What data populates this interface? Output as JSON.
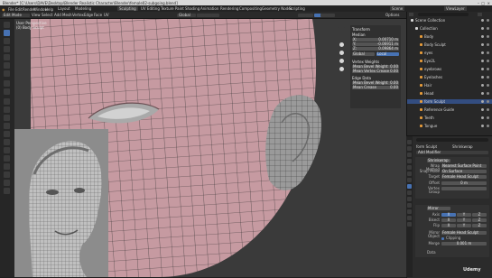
{
  "titlebar": {
    "title": "Blender* [C:\\Users\\DAVE\\Desktop\\Blender Realistic Character\\Blender\\female02-subgoing.blend]"
  },
  "menubar": {
    "menus": [
      "File",
      "Edit",
      "Render",
      "Window",
      "Help"
    ],
    "workspaces": [
      "Layout",
      "Modeling",
      "Sculpting",
      "UV Editing",
      "Texture Paint",
      "Shading",
      "Animation",
      "Rendering",
      "Compositing",
      "Geometry Nodes",
      "Scripting"
    ],
    "active_workspace": "Modeling",
    "scene_label": "Scene",
    "view_layer_label": "ViewLayer"
  },
  "header": {
    "mode": "Edit Mode",
    "menus": [
      "View",
      "Select",
      "Add",
      "Mesh",
      "Vertex",
      "Edge",
      "Face",
      "UV"
    ],
    "orientation": "Global",
    "options_label": "Options"
  },
  "viewport": {
    "view_name": "User Perspective",
    "object_name": "(0) Body Sculpt",
    "accent_skin": "#c89aa0",
    "ref_bg": "#8c8c8c",
    "watermark": "Udemy"
  },
  "npanel": {
    "transform_title": "Transform",
    "median_label": "Median",
    "x_label": "X:",
    "x_value": "0.00710 m",
    "y_label": "Y:",
    "y_value": "-0.06911 m",
    "z_label": "Z:",
    "z_value": "0.09864 m",
    "space_global": "Global",
    "space_local": "Local",
    "vertex_weights": "Vertex Weights",
    "mean_bevel_weight": "Mean Bevel Weight",
    "mean_bevel_weight_val": "0.00",
    "mean_vertex_crease": "Mean Vertex Crease",
    "mean_vertex_crease_val": "0.00",
    "edge_data": "Edge Data",
    "mean_bevel_weight_e": "Mean Bevel Weight",
    "mean_bevel_weight_e_val": "0.00",
    "mean_crease": "Mean Crease",
    "mean_crease_val": "0.00"
  },
  "outliner": {
    "search_placeholder": "",
    "rows": [
      {
        "label": "Scene Collection",
        "indent": 0,
        "color": "#d6d6d6",
        "sel": false
      },
      {
        "label": "Collection",
        "indent": 1,
        "color": "#d6d6d6",
        "sel": false
      },
      {
        "label": "Body",
        "indent": 2,
        "color": "#e69b3a",
        "sel": false
      },
      {
        "label": "Body Sculpt",
        "indent": 2,
        "color": "#e69b3a",
        "sel": false
      },
      {
        "label": "eyes",
        "indent": 2,
        "color": "#e69b3a",
        "sel": false
      },
      {
        "label": "Eye2L",
        "indent": 2,
        "color": "#e69b3a",
        "sel": false
      },
      {
        "label": "eyebrows",
        "indent": 2,
        "color": "#e69b3a",
        "sel": false
      },
      {
        "label": "Eyelashes",
        "indent": 2,
        "color": "#e69b3a",
        "sel": false
      },
      {
        "label": "Hair",
        "indent": 2,
        "color": "#e69b3a",
        "sel": false
      },
      {
        "label": "Head",
        "indent": 2,
        "color": "#e69b3a",
        "sel": false
      },
      {
        "label": "form Sculpt",
        "indent": 2,
        "color": "#e69b3a",
        "sel": true
      },
      {
        "label": "Reference Guide",
        "indent": 2,
        "color": "#e69b3a",
        "sel": false
      },
      {
        "label": "Teeth",
        "indent": 2,
        "color": "#e69b3a",
        "sel": false
      },
      {
        "label": "Tongue",
        "indent": 2,
        "color": "#e69b3a",
        "sel": false
      }
    ]
  },
  "props": {
    "object_name": "form Sculpt",
    "modifier_name": "Shrinkwrap",
    "add_modifier": "Add Modifier",
    "mod1_name": "Shrinkwrap",
    "wrap_method_label": "Wrap Method",
    "wrap_method_val": "Nearest Surface Point",
    "snap_mode_label": "Snap Mode",
    "snap_mode_val": "On Surface",
    "target_label": "Target",
    "target_val": "Female Head Sculpt",
    "offset_label": "Offset",
    "offset_val": "0 m",
    "vertex_group_label": "Vertex Group",
    "mod2_name": "Mirror",
    "axis_label": "Axis",
    "bisect_label": "Bisect",
    "flip_label": "Flip",
    "x": "X",
    "y": "Y",
    "z": "Z",
    "mirror_object_label": "Mirror Object",
    "mirror_object_val": "Female Head Sculpt",
    "clipping_label": "Clipping",
    "merge_label": "Merge",
    "merge_val": "0.001 m",
    "data_label": "Data"
  }
}
